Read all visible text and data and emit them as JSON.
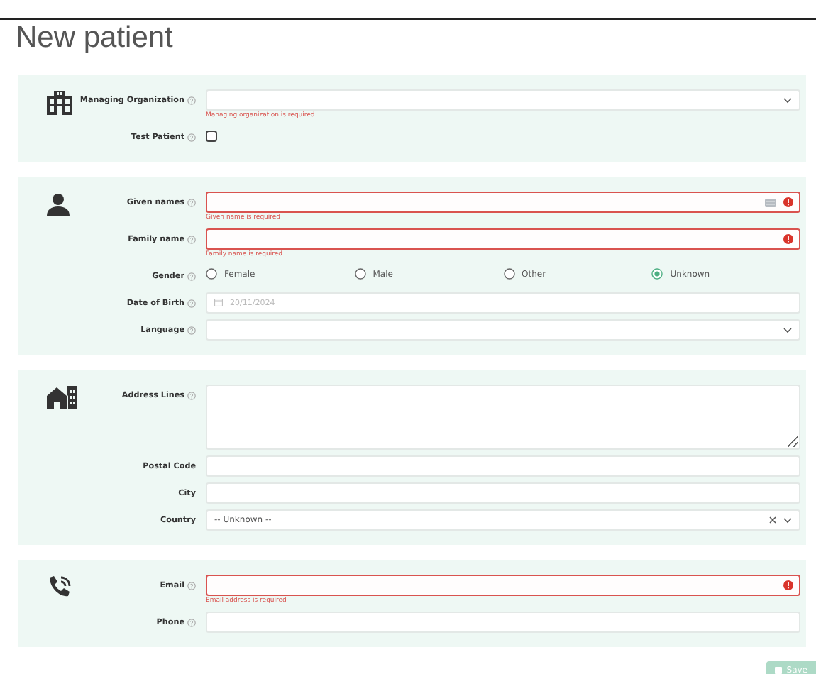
{
  "title": "New patient",
  "sections": [
    {
      "kind": "building",
      "fields": [
        {
          "kind": "select",
          "label": "Managing Organization",
          "help": true,
          "invalid": false,
          "error": "Managing organization is required"
        },
        {
          "kind": "checkbox",
          "label": "Test Patient",
          "help": true,
          "checked": false
        }
      ]
    },
    {
      "kind": "person",
      "fields": [
        {
          "kind": "text",
          "label": "Given names",
          "help": true,
          "invalid": true,
          "keyboard": true,
          "error": "Given name is required"
        },
        {
          "kind": "text",
          "label": "Family name",
          "help": true,
          "invalid": true,
          "error": "Family name is required"
        },
        {
          "kind": "radio",
          "label": "Gender",
          "help": true,
          "options": [
            {
              "label": "Female",
              "selected": false
            },
            {
              "label": "Male",
              "selected": false
            },
            {
              "label": "Other",
              "selected": false
            },
            {
              "label": "Unknown",
              "selected": true
            }
          ]
        },
        {
          "kind": "date",
          "label": "Date of Birth",
          "help": true,
          "placeholder": "20/11/2024"
        },
        {
          "kind": "select",
          "label": "Language",
          "help": true,
          "invalid": false
        }
      ]
    },
    {
      "kind": "house",
      "fields": [
        {
          "kind": "textarea",
          "label": "Address Lines",
          "help": true
        },
        {
          "kind": "text",
          "label": "Postal Code",
          "help": false,
          "invalid": false
        },
        {
          "kind": "text",
          "label": "City",
          "help": false,
          "invalid": false
        },
        {
          "kind": "select",
          "label": "Country",
          "help": false,
          "invalid": false,
          "value": "-- Unknown --",
          "clearable": true
        }
      ]
    },
    {
      "kind": "phone",
      "fields": [
        {
          "kind": "text",
          "label": "Email",
          "help": true,
          "invalid": true,
          "error": "Email address is required"
        },
        {
          "kind": "text",
          "label": "Phone",
          "help": true,
          "invalid": false
        }
      ]
    }
  ],
  "save_button": {
    "label": "Save",
    "disabled": true
  }
}
